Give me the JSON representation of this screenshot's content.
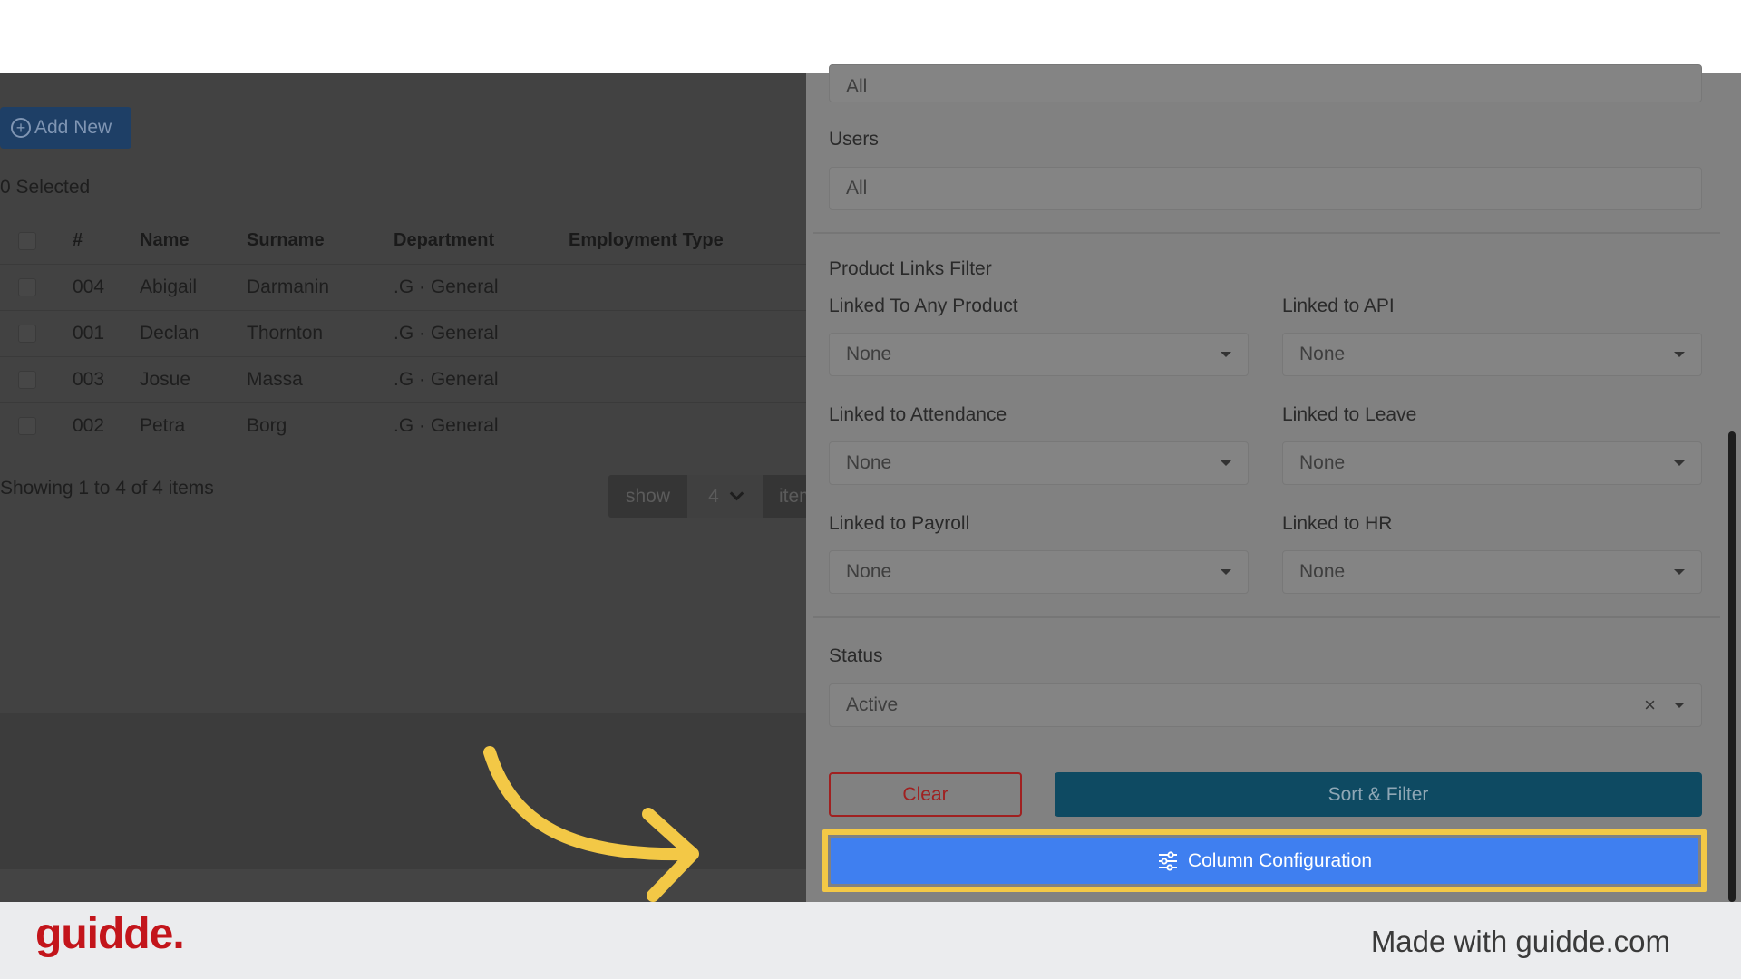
{
  "left": {
    "add_new_label": "Add New",
    "selected_text": "0 Selected",
    "table": {
      "headers": [
        "#",
        "Name",
        "Surname",
        "Department",
        "Employment Type"
      ],
      "rows": [
        {
          "num": "004",
          "name": "Abigail",
          "surname": "Darmanin",
          "department": ".G · General",
          "employment_type": ""
        },
        {
          "num": "001",
          "name": "Declan",
          "surname": "Thornton",
          "department": ".G · General",
          "employment_type": ""
        },
        {
          "num": "003",
          "name": "Josue",
          "surname": "Massa",
          "department": ".G · General",
          "employment_type": ""
        },
        {
          "num": "002",
          "name": "Petra",
          "surname": "Borg",
          "department": ".G · General",
          "employment_type": ""
        }
      ]
    },
    "showing_text": "Showing 1 to 4 of 4 items",
    "pager": {
      "show_label": "show",
      "page_size": "4",
      "items_label": "items"
    }
  },
  "panel": {
    "top_field_value": "All",
    "users_label": "Users",
    "users_value": "All",
    "product_links_title": "Product Links Filter",
    "filters": [
      {
        "label": "Linked To Any Product",
        "value": "None"
      },
      {
        "label": "Linked to API",
        "value": "None"
      },
      {
        "label": "Linked to Attendance",
        "value": "None"
      },
      {
        "label": "Linked to Leave",
        "value": "None"
      },
      {
        "label": "Linked to Payroll",
        "value": "None"
      },
      {
        "label": "Linked to HR",
        "value": "None"
      }
    ],
    "status_label": "Status",
    "status_value": "Active",
    "clear_label": "Clear",
    "sort_filter_label": "Sort & Filter",
    "column_config_label": "Column Configuration"
  },
  "colors": {
    "highlight": "#f3c846",
    "column_config_button": "#3f7ff0",
    "sort_button": "#0e4a62",
    "brand": "#c3151b"
  },
  "footer": {
    "logo": "guidde.",
    "made_with": "Made with guidde.com"
  }
}
